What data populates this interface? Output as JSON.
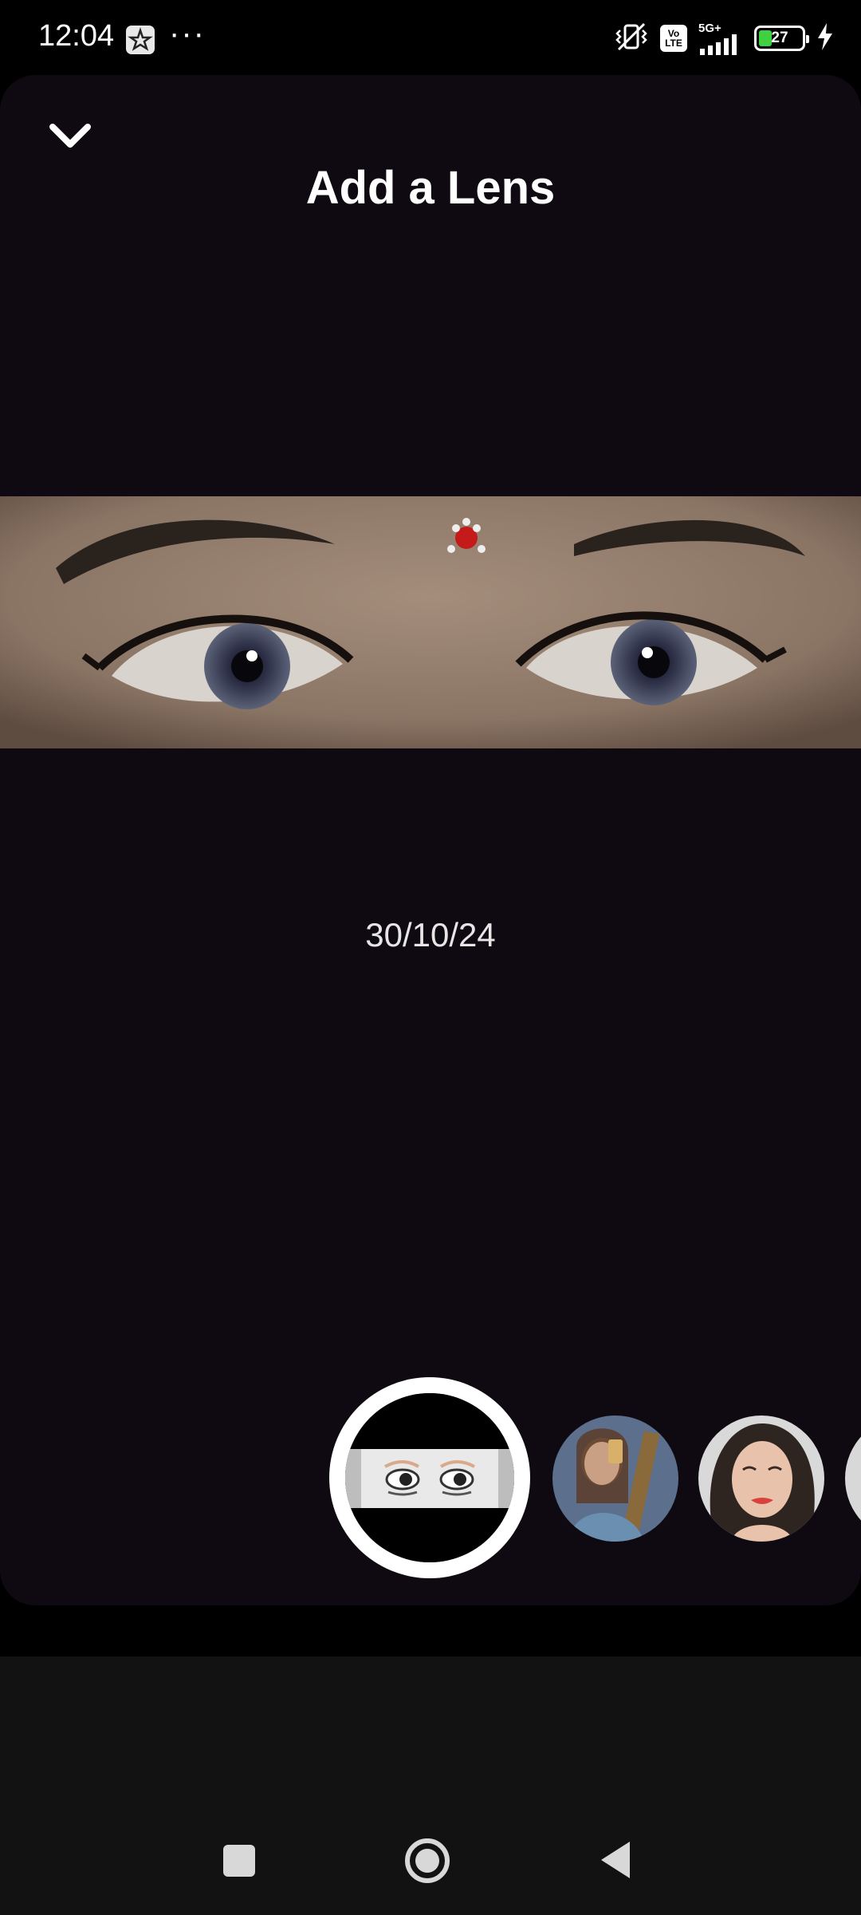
{
  "status_bar": {
    "time": "12:04",
    "overflow_dots": "···",
    "volte_label_top": "Vo",
    "volte_label_bottom": "LTE",
    "network_label": "5G+",
    "battery_level": "27"
  },
  "header": {
    "title": "Add a Lens"
  },
  "main": {
    "date": "30/10/24"
  },
  "lens_carousel": {
    "selected_lens": "eyes-lens",
    "thumbnails": [
      "portrait-lens-1",
      "portrait-lens-2",
      "lens-3"
    ]
  },
  "colors": {
    "background": "#0f0a12",
    "selected_ring": "#ffffff",
    "battery_fill": "#3fd13f"
  }
}
